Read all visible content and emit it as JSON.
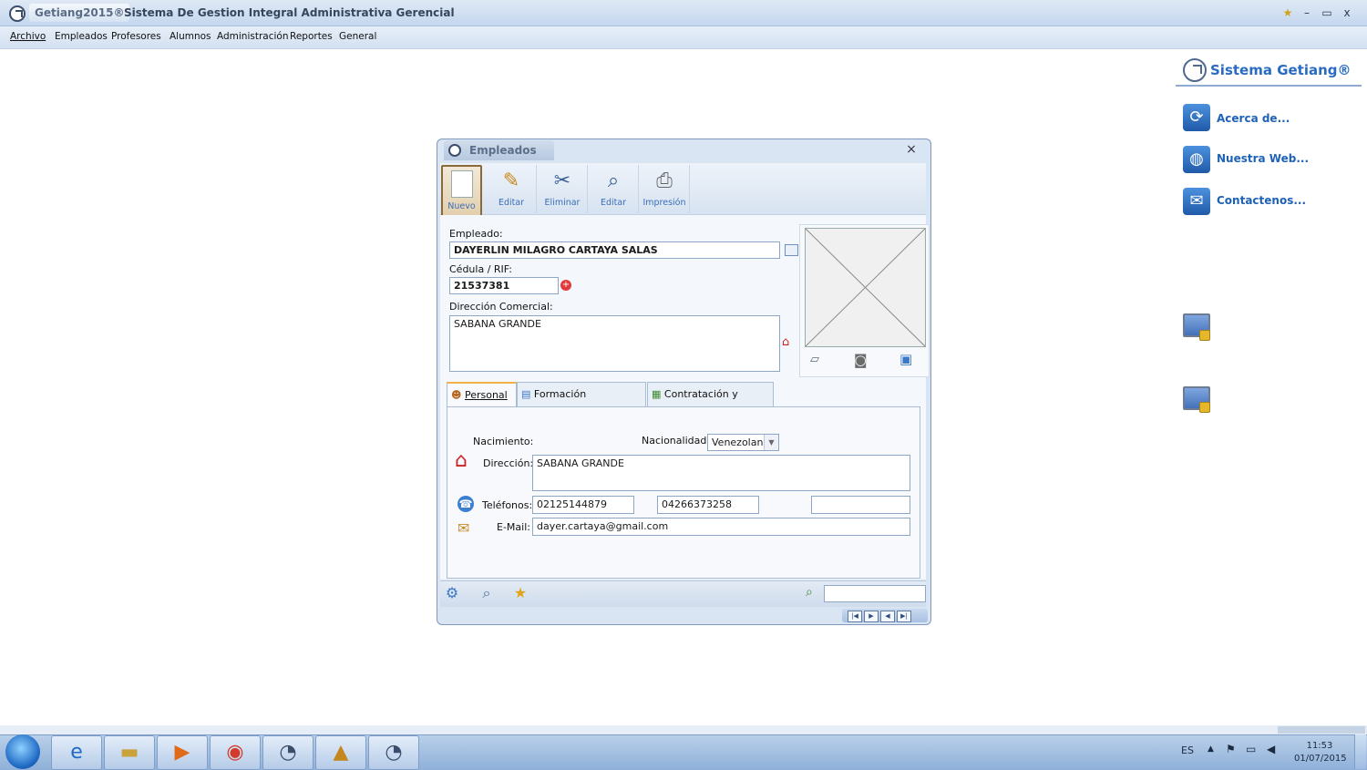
{
  "titlebar": {
    "app_name": "Getiang2015®",
    "title": "Sistema De Gestion Integral Administrativa Gerencial",
    "minimize": "–",
    "maximize": "▭",
    "close": "x"
  },
  "menu": [
    "Archivo",
    "Empleados",
    "Profesores",
    "Alumnos",
    "Administración",
    "Reportes",
    "General"
  ],
  "right_panel": {
    "title": "Sistema Getiang®",
    "links": [
      "Acerca de...",
      "Nuestra Web...",
      "Contactenos..."
    ]
  },
  "dialog": {
    "title": "Empleados",
    "close": "×",
    "toolbar": [
      "Nuevo",
      "Editar",
      "Eliminar",
      "Editar",
      "Impresión"
    ],
    "empleado_label": "Empleado:",
    "empleado_value": "DAYERLIN MILAGRO CARTAYA SALAS",
    "cedula_label": "Cédula / RIF:",
    "cedula_value": "21537381",
    "direccion_comercial_label": "Dirección Comercial:",
    "direccion_comercial_value": "SABANA GRANDE",
    "tabs": [
      "Personal",
      "Formación Académica",
      "Contratación y Sueldo"
    ],
    "personal": {
      "nacimiento_label": "Nacimiento:",
      "nacionalidad_label": "Nacionalidad:",
      "nacionalidad_value": "Venezolano",
      "direccion_label": "Dirección:",
      "direccion_value": "SABANA GRANDE",
      "telefonos_label": "Teléfonos:",
      "telefono_1": "02125144879",
      "telefono_2": "04266373258",
      "telefono_3": "",
      "email_label": "E-Mail:",
      "email_value": "dayer.cartaya@gmail.com"
    },
    "search_value": ""
  },
  "taskbar": {
    "language": "ES",
    "time": "11:53",
    "date": "01/07/2015"
  }
}
